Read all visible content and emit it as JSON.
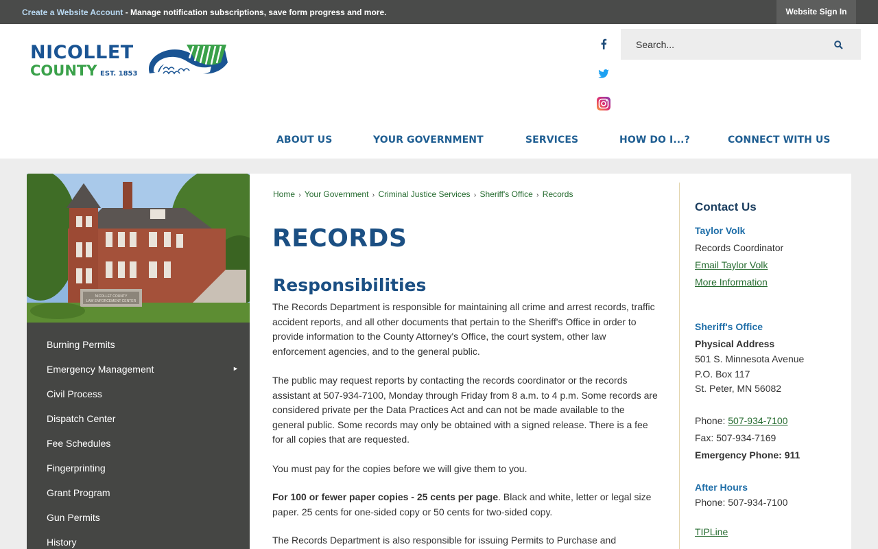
{
  "topbar": {
    "create_account": "Create a Website Account",
    "message": " - Manage notification subscriptions, save form progress and more.",
    "sign_in": "Website Sign In"
  },
  "logo": {
    "word1": "NICOLLET",
    "word2": "COUNTY",
    "est": "EST. 1853"
  },
  "social": [
    "facebook-icon",
    "twitter-icon",
    "instagram-icon"
  ],
  "search": {
    "placeholder": "Search..."
  },
  "nav": [
    "ABOUT US",
    "YOUR GOVERNMENT",
    "SERVICES",
    "HOW DO I...?",
    "CONNECT WITH US"
  ],
  "photo_sign": [
    "NICOLLET COUNTY",
    "LAW ENFORCEMENT CENTER"
  ],
  "sidebar": {
    "items": [
      "Burning Permits",
      "Emergency Management",
      "Civil Process",
      "Dispatch Center",
      "Fee Schedules",
      "Fingerprinting",
      "Grant Program",
      "Gun Permits",
      "History"
    ],
    "arrow": "►"
  },
  "breadcrumb": [
    "Home",
    "Your Government",
    "Criminal Justice Services",
    "Sheriff's Office",
    "Records"
  ],
  "breadcrumb_sep": "›",
  "main": {
    "title": "RECORDS",
    "heading": "Responsibilities",
    "p1": "The Records Department is responsible for maintaining all crime and arrest records, traffic accident reports, and all other documents that pertain to the Sheriff's Office in order to provide information to the County Attorney's Office, the court system, other law enforcement agencies, and to the general public.",
    "p2": "The public may request reports by contacting the records coordinator or the records assistant at 507-934-7100, Monday through Friday from 8 a.m. to 4 p.m. Some records are considered private per the Data Practices Act and can not be made available to the general public. Some records may only be obtained with a signed release. There is a fee for all copies that are requested.",
    "p3": "You must pay for the copies before we will give them to you.",
    "p4_bold": "For 100 or fewer paper copies - 25 cents per page",
    "p4_rest": ".  Black and white, letter or legal size paper.  25 cents for one-sided copy or 50 cents for two-sided copy.",
    "p5": "The Records Department is also responsible for issuing Permits to Purchase and"
  },
  "contact": {
    "heading": "Contact Us",
    "name": "Taylor Volk",
    "role": "Records Coordinator",
    "email_link": "Email Taylor Volk",
    "more_info": "More Information",
    "office": "Sheriff's Office",
    "address_label": "Physical Address",
    "address1": "501 S. Minnesota Avenue",
    "address2": "P.O. Box 117",
    "address3": "St. Peter, MN 56082",
    "phone_label": "Phone: ",
    "phone": "507-934-7100",
    "fax": "Fax: 507-934-7169",
    "emergency": "Emergency Phone: 911",
    "after_hours": "After Hours",
    "after_phone": "Phone: 507-934-7100",
    "tipline": "TIPLine"
  }
}
